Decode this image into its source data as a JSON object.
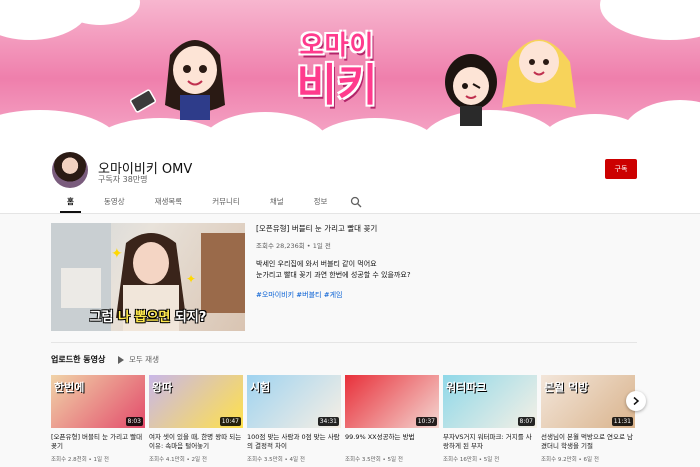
{
  "banner": {
    "title_line1": "오마이",
    "title_line2": "비키"
  },
  "channel": {
    "name": "오마이비키 OMV",
    "subscribers": "구독자 38만명",
    "subscribe_label": "구독"
  },
  "tabs": [
    {
      "label": "홈",
      "active": true
    },
    {
      "label": "동영상"
    },
    {
      "label": "재생목록"
    },
    {
      "label": "커뮤니티"
    },
    {
      "label": "채널"
    },
    {
      "label": "정보"
    }
  ],
  "featured": {
    "title": "[오픈유형] 버블티 눈 가리고 빨대 꽂기",
    "meta": "조회수 28,236회 • 1일 전",
    "desc_line1": "박세인 우리집에 와서 버블티 같이 먹어요",
    "desc_line2": "눈가리고 빨대 꽂기 과연 한번에 성공할 수 있을까요?",
    "tags": "#오마이비키 #버블티 #게임",
    "caption_white": "그럼 ",
    "caption_yellow": "나 뽑으면",
    "caption_end": " 되지?"
  },
  "uploads": {
    "section_title": "업로드한 동영상",
    "play_all": "모두 재생",
    "videos": [
      {
        "title": "[오픈유형] 버블티 눈 가리고 빨대 꽂기",
        "meta": "조회수 2.8천회 • 1일 전",
        "duration": "8:03",
        "thumb_text": "한번에",
        "color1": "#f0d3a8",
        "color2": "#e34b6b"
      },
      {
        "title": "여자 셋이 있을 때, 한명 왕따 되는 이유: 속마음 털어놓기",
        "meta": "조회수 4.1만회 • 2일 전",
        "duration": "10:47",
        "thumb_text": "왕따",
        "color1": "#c9b7e8",
        "color2": "#ffe14a"
      },
      {
        "title": "100점 맞는 사람과 0점 맞는 사람의 결정적 차이",
        "meta": "조회수 3.5만회 • 4일 전",
        "duration": "34:31",
        "thumb_text": "시험",
        "color1": "#9fd3f0",
        "color2": "#f7efe4"
      },
      {
        "title": "99.9% XX성공하는 방법",
        "meta": "조회수 3.5만회 • 5일 전",
        "duration": "10:37",
        "thumb_text": "",
        "color1": "#e8303a",
        "color2": "#f4d7d2"
      },
      {
        "title": "부자VS거지 워터파크: 거지를 사랑하게 된 부자",
        "meta": "조회수 16만회 • 5일 전",
        "duration": "8:07",
        "thumb_text": "워터파크",
        "color1": "#8fd8e8",
        "color2": "#f5f0e6"
      },
      {
        "title": "선생님이 본월 먹방으로 연오로 남겼더니 학생을 기절",
        "meta": "조회수 9.2만회 • 6일 전",
        "duration": "11:31",
        "thumb_text": "본월 먹방",
        "color1": "#f3e6da",
        "color2": "#d9b38c"
      }
    ]
  }
}
